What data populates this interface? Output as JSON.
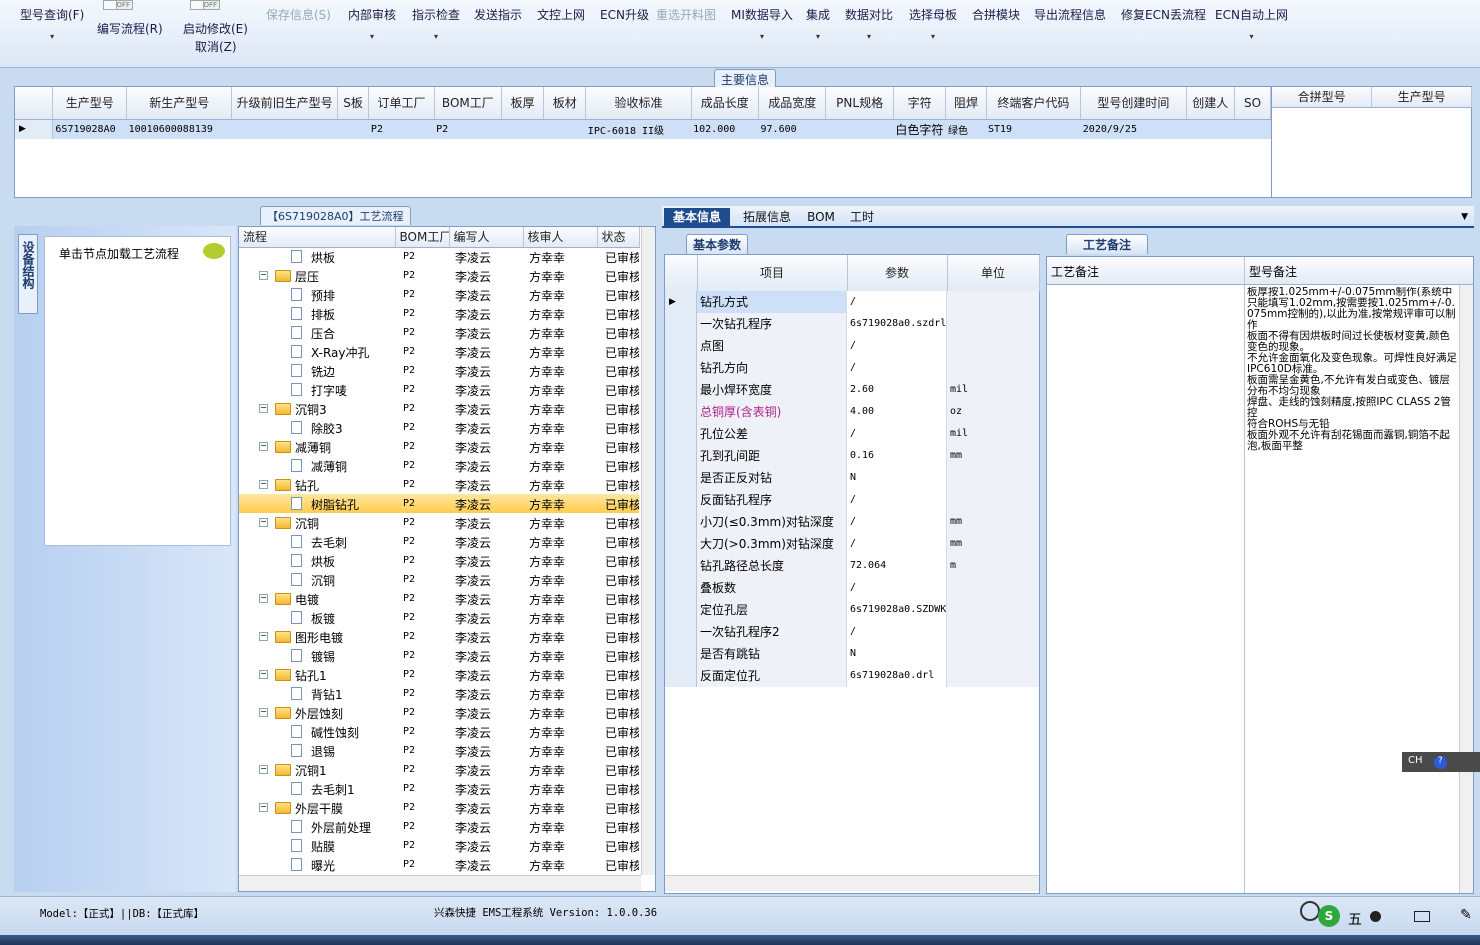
{
  "toolbar": {
    "items": [
      {
        "label": "型号查询(F)",
        "disabled": false,
        "dropdown": true
      },
      {
        "label": "编写流程(R)",
        "disabled": false,
        "dropdown": false
      },
      {
        "label": "启动修改(E)",
        "disabled": false,
        "dropdown": false
      },
      {
        "label": "保存信息(S)",
        "disabled": true,
        "dropdown": false
      },
      {
        "label": "内部审核",
        "disabled": false,
        "dropdown": true
      },
      {
        "label": "指示检查",
        "disabled": false,
        "dropdown": true
      },
      {
        "label": "发送指示",
        "disabled": false,
        "dropdown": false
      },
      {
        "label": "文控上网",
        "disabled": false,
        "dropdown": false
      },
      {
        "label": "ECN升级",
        "disabled": false,
        "dropdown": false
      },
      {
        "label": "重选开料图",
        "disabled": true,
        "dropdown": false
      },
      {
        "label": "MI数据导入",
        "disabled": false,
        "dropdown": true
      },
      {
        "label": "集成",
        "disabled": false,
        "dropdown": true
      },
      {
        "label": "数据对比",
        "disabled": false,
        "dropdown": true
      },
      {
        "label": "选择母板",
        "disabled": false,
        "dropdown": true
      },
      {
        "label": "合拼模块",
        "disabled": false,
        "dropdown": false
      },
      {
        "label": "导出流程信息",
        "disabled": false,
        "dropdown": false
      },
      {
        "label": "修复ECN丢流程",
        "disabled": false,
        "dropdown": false
      },
      {
        "label": "ECN自动上网",
        "disabled": false,
        "dropdown": true
      }
    ],
    "cancel_label": "取消(Z)",
    "toggle_off": "OFF"
  },
  "main_info": {
    "caption": "主要信息",
    "columns": [
      "生产型号",
      "新生产型号",
      "升级前旧生产型号",
      "S板",
      "订单工厂",
      "BOM工厂",
      "板厚",
      "板材",
      "验收标准",
      "成品长度",
      "成品宽度",
      "PNL规格",
      "字符",
      "阻焊",
      "终端客户代码",
      "型号创建时间",
      "创建人",
      "SO"
    ],
    "row": [
      "6S719028A0",
      "10010600088139",
      "",
      "",
      "P2",
      "P2",
      "",
      "",
      "IPC-6018 II级",
      "102.000",
      "97.600",
      "",
      "白色字符",
      "绿色",
      "ST19",
      "2020/9/25",
      "",
      ""
    ],
    "side_columns": [
      "合拼型号",
      "生产型号"
    ]
  },
  "left_panel": {
    "vertical_tab": "设备结构",
    "hint": "单击节点加载工艺流程"
  },
  "process": {
    "caption": "【6S719028A0】工艺流程",
    "columns": [
      "流程",
      "BOM工厂",
      "编写人",
      "核审人",
      "状态"
    ],
    "rows": [
      {
        "level": 2,
        "type": "doc",
        "name": "烘板",
        "bom": "P2",
        "writer": "李凌云",
        "reviewer": "方幸幸",
        "status": "已审核"
      },
      {
        "level": 1,
        "type": "folder",
        "name": "层压",
        "bom": "P2",
        "writer": "李凌云",
        "reviewer": "方幸幸",
        "status": "已审核"
      },
      {
        "level": 2,
        "type": "doc",
        "name": "预排",
        "bom": "P2",
        "writer": "李凌云",
        "reviewer": "方幸幸",
        "status": "已审核"
      },
      {
        "level": 2,
        "type": "doc",
        "name": "排板",
        "bom": "P2",
        "writer": "李凌云",
        "reviewer": "方幸幸",
        "status": "已审核"
      },
      {
        "level": 2,
        "type": "doc",
        "name": "压合",
        "bom": "P2",
        "writer": "李凌云",
        "reviewer": "方幸幸",
        "status": "已审核"
      },
      {
        "level": 2,
        "type": "doc",
        "name": "X-Ray冲孔",
        "bom": "P2",
        "writer": "李凌云",
        "reviewer": "方幸幸",
        "status": "已审核"
      },
      {
        "level": 2,
        "type": "doc",
        "name": "铣边",
        "bom": "P2",
        "writer": "李凌云",
        "reviewer": "方幸幸",
        "status": "已审核"
      },
      {
        "level": 2,
        "type": "doc",
        "name": "打字唛",
        "bom": "P2",
        "writer": "李凌云",
        "reviewer": "方幸幸",
        "status": "已审核"
      },
      {
        "level": 1,
        "type": "folder",
        "name": "沉铜3",
        "bom": "P2",
        "writer": "李凌云",
        "reviewer": "方幸幸",
        "status": "已审核"
      },
      {
        "level": 2,
        "type": "doc",
        "name": "除胶3",
        "bom": "P2",
        "writer": "李凌云",
        "reviewer": "方幸幸",
        "status": "已审核"
      },
      {
        "level": 1,
        "type": "folder",
        "name": "减薄铜",
        "bom": "P2",
        "writer": "李凌云",
        "reviewer": "方幸幸",
        "status": "已审核"
      },
      {
        "level": 2,
        "type": "doc",
        "name": "减薄铜",
        "bom": "P2",
        "writer": "李凌云",
        "reviewer": "方幸幸",
        "status": "已审核"
      },
      {
        "level": 1,
        "type": "folder",
        "name": "钻孔",
        "bom": "P2",
        "writer": "李凌云",
        "reviewer": "方幸幸",
        "status": "已审核"
      },
      {
        "level": 2,
        "type": "doc",
        "name": "树脂钻孔",
        "bom": "P2",
        "writer": "李凌云",
        "reviewer": "方幸幸",
        "status": "已审核",
        "selected": true
      },
      {
        "level": 1,
        "type": "folder",
        "name": "沉铜",
        "bom": "P2",
        "writer": "李凌云",
        "reviewer": "方幸幸",
        "status": "已审核"
      },
      {
        "level": 2,
        "type": "doc",
        "name": "去毛刺",
        "bom": "P2",
        "writer": "李凌云",
        "reviewer": "方幸幸",
        "status": "已审核"
      },
      {
        "level": 2,
        "type": "doc",
        "name": "烘板",
        "bom": "P2",
        "writer": "李凌云",
        "reviewer": "方幸幸",
        "status": "已审核"
      },
      {
        "level": 2,
        "type": "doc",
        "name": "沉铜",
        "bom": "P2",
        "writer": "李凌云",
        "reviewer": "方幸幸",
        "status": "已审核"
      },
      {
        "level": 1,
        "type": "folder",
        "name": "电镀",
        "bom": "P2",
        "writer": "李凌云",
        "reviewer": "方幸幸",
        "status": "已审核"
      },
      {
        "level": 2,
        "type": "doc",
        "name": "板镀",
        "bom": "P2",
        "writer": "李凌云",
        "reviewer": "方幸幸",
        "status": "已审核"
      },
      {
        "level": 1,
        "type": "folder",
        "name": "图形电镀",
        "bom": "P2",
        "writer": "李凌云",
        "reviewer": "方幸幸",
        "status": "已审核"
      },
      {
        "level": 2,
        "type": "doc",
        "name": "镀锡",
        "bom": "P2",
        "writer": "李凌云",
        "reviewer": "方幸幸",
        "status": "已审核"
      },
      {
        "level": 1,
        "type": "folder",
        "name": "钻孔1",
        "bom": "P2",
        "writer": "李凌云",
        "reviewer": "方幸幸",
        "status": "已审核"
      },
      {
        "level": 2,
        "type": "doc",
        "name": "背钻1",
        "bom": "P2",
        "writer": "李凌云",
        "reviewer": "方幸幸",
        "status": "已审核"
      },
      {
        "level": 1,
        "type": "folder",
        "name": "外层蚀刻",
        "bom": "P2",
        "writer": "李凌云",
        "reviewer": "方幸幸",
        "status": "已审核"
      },
      {
        "level": 2,
        "type": "doc",
        "name": "碱性蚀刻",
        "bom": "P2",
        "writer": "李凌云",
        "reviewer": "方幸幸",
        "status": "已审核"
      },
      {
        "level": 2,
        "type": "doc",
        "name": "退锡",
        "bom": "P2",
        "writer": "李凌云",
        "reviewer": "方幸幸",
        "status": "已审核"
      },
      {
        "level": 1,
        "type": "folder",
        "name": "沉铜1",
        "bom": "P2",
        "writer": "李凌云",
        "reviewer": "方幸幸",
        "status": "已审核"
      },
      {
        "level": 2,
        "type": "doc",
        "name": "去毛刺1",
        "bom": "P2",
        "writer": "李凌云",
        "reviewer": "方幸幸",
        "status": "已审核"
      },
      {
        "level": 1,
        "type": "folder",
        "name": "外层干膜",
        "bom": "P2",
        "writer": "李凌云",
        "reviewer": "方幸幸",
        "status": "已审核"
      },
      {
        "level": 2,
        "type": "doc",
        "name": "外层前处理",
        "bom": "P2",
        "writer": "李凌云",
        "reviewer": "方幸幸",
        "status": "已审核"
      },
      {
        "level": 2,
        "type": "doc",
        "name": "贴膜",
        "bom": "P2",
        "writer": "李凌云",
        "reviewer": "方幸幸",
        "status": "已审核"
      },
      {
        "level": 2,
        "type": "doc",
        "name": "曝光",
        "bom": "P2",
        "writer": "李凌云",
        "reviewer": "方幸幸",
        "status": "已审核"
      }
    ]
  },
  "right_tabs": [
    "基本信息",
    "拓展信息",
    "BOM",
    "工时"
  ],
  "params": {
    "caption": "基本参数",
    "columns": [
      "项目",
      "参数",
      "单位"
    ],
    "rows": [
      {
        "item": "钻孔方式",
        "value": "/",
        "unit": "",
        "selected": true
      },
      {
        "item": "一次钻孔程序",
        "value": "6s719028a0.szdrl",
        "unit": ""
      },
      {
        "item": "点图",
        "value": "/",
        "unit": ""
      },
      {
        "item": "钻孔方向",
        "value": "/",
        "unit": ""
      },
      {
        "item": "最小焊环宽度",
        "value": "2.60",
        "unit": "mil"
      },
      {
        "item": "总铜厚(含表铜)",
        "value": "4.00",
        "unit": "oz",
        "highlight": "#b0208a"
      },
      {
        "item": "孔位公差",
        "value": "/",
        "unit": "mil"
      },
      {
        "item": "孔到孔间距",
        "value": "0.16",
        "unit": "mm"
      },
      {
        "item": "是否正反对钻",
        "value": "N",
        "unit": ""
      },
      {
        "item": "反面钻孔程序",
        "value": "/",
        "unit": ""
      },
      {
        "item": "小刀(≤0.3mm)对钻深度",
        "value": "/",
        "unit": "mm"
      },
      {
        "item": "大刀(>0.3mm)对钻深度",
        "value": "/",
        "unit": "mm"
      },
      {
        "item": "钻孔路径总长度",
        "value": "72.064",
        "unit": "m"
      },
      {
        "item": "叠板数",
        "value": "/",
        "unit": ""
      },
      {
        "item": "定位孔层",
        "value": "6s719028a0.SZDWK",
        "unit": ""
      },
      {
        "item": "一次钻孔程序2",
        "value": "/",
        "unit": ""
      },
      {
        "item": "是否有跳钻",
        "value": "N",
        "unit": ""
      },
      {
        "item": "反面定位孔",
        "value": "6s719028a0.drl",
        "unit": ""
      }
    ]
  },
  "remarks": {
    "caption": "工艺备注",
    "col_process": "工艺备注",
    "col_model": "型号备注",
    "model_text": "板厚按1.025mm+/-0.075mm制作(系统中只能填写1.02mm,按需要按1.025mm+/-0.075mm控制的),以此为准,按常规评审可以制作\n板面不得有因烘板时间过长使板材变黄,颜色变色的现象。\n不允许金面氧化及变色现象。可焊性良好满足IPC610D标准。\n板面需呈金黄色,不允许有发白或变色、镀层分布不均匀现象\n焊盘、走线的蚀刻精度,按照IPC CLASS 2管控\n符合ROHS与无铅\n板面外观不允许有刮花锡面而露铜,铜箔不起泡,板面平整"
  },
  "status": {
    "left": "Model:【正式】||DB:【正式库】",
    "center": "兴森快捷 EMS工程系统 Version: 1.0.0.36"
  },
  "ime": {
    "label": "CH",
    "glyph": "五"
  },
  "colors": {
    "accent": "#1e4c8e",
    "selected_row": "#ffd966",
    "header_blue": "#cfe0f6"
  }
}
